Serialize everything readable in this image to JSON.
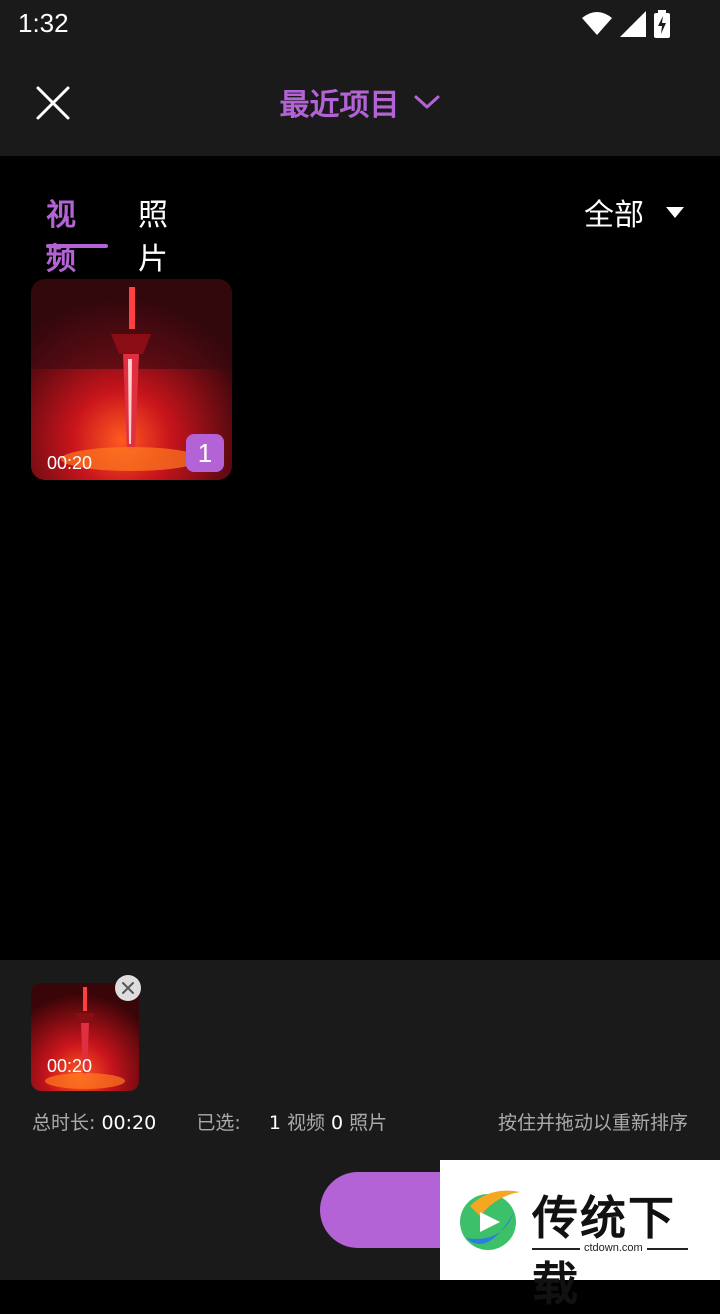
{
  "status_bar": {
    "time": "1:32"
  },
  "header": {
    "title": "最近项目"
  },
  "tabs": [
    {
      "label": "视频",
      "active": true
    },
    {
      "label": "照片",
      "active": false
    }
  ],
  "filter": {
    "label": "全部"
  },
  "media_grid": [
    {
      "duration": "00:20",
      "selected_index": "1"
    }
  ],
  "selected_tray": {
    "items": [
      {
        "duration": "00:20"
      }
    ],
    "total_label": "总时长:",
    "total_value": "00:20",
    "selected_label": "已选:",
    "video_count": "1",
    "video_label": "视频",
    "photo_count": "0",
    "photo_label": "照片",
    "hint": "按住并拖动以重新排序"
  },
  "watermark": {
    "title": "传统下载",
    "subtitle": "ctdown.com"
  },
  "colors": {
    "accent": "#b363d6",
    "background": "#000000",
    "panel": "#1a1a1a"
  }
}
